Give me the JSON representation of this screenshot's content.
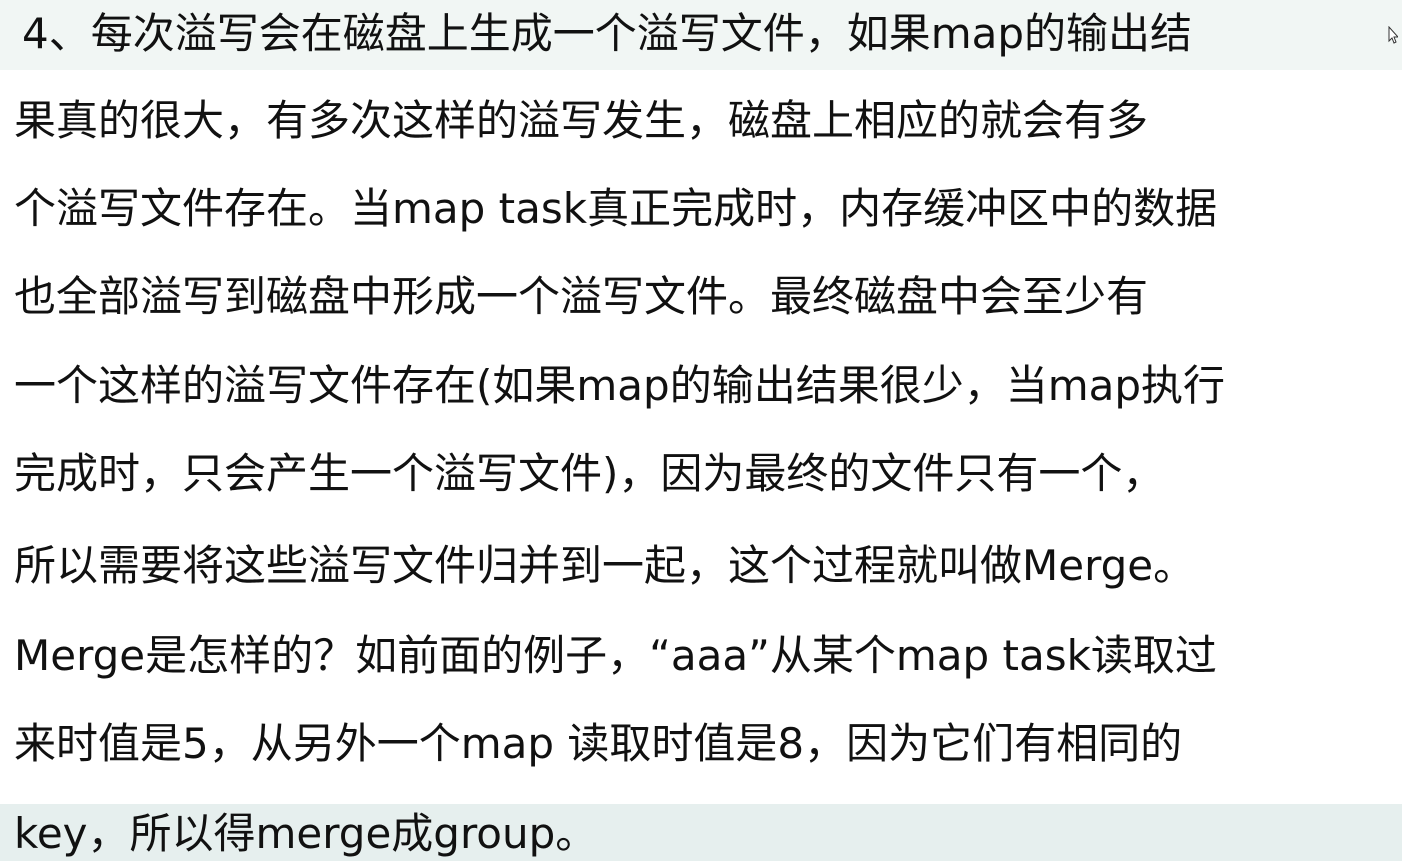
{
  "paragraph": {
    "lines": [
      "4、每次溢写会在磁盘上生成一个溢写文件，如果map的输出结",
      "果真的很大，有多次这样的溢写发生，磁盘上相应的就会有多",
      "个溢写文件存在。当map task真正完成时，内存缓冲区中的数据",
      "也全部溢写到磁盘中形成一个溢写文件。最终磁盘中会至少有",
      "一个这样的溢写文件存在(如果map的输出结果很少，当map执行",
      "完成时，只会产生一个溢写文件)，因为最终的文件只有一个，",
      "所以需要将这些溢写文件归并到一起，这个过程就叫做Merge。",
      "Merge是怎样的？如前面的例子，“aaa”从某个map task读取过",
      "来时值是5，从另外一个map 读取时值是8，因为它们有相同的",
      "key，所以得merge成group。"
    ]
  },
  "colors": {
    "text": "#111111",
    "band_top": "#f1f6f4",
    "band_bottom": "#e6efee"
  },
  "icons": {
    "cursor": "mouse-cursor-icon"
  }
}
